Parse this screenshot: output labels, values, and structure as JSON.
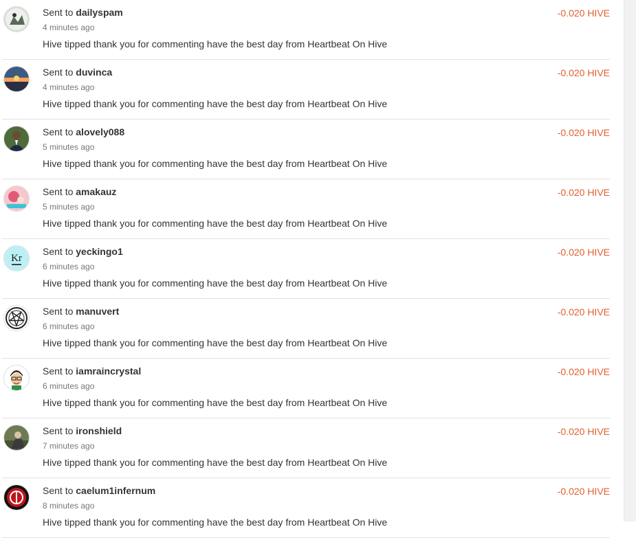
{
  "transfers": [
    {
      "prefix": "Sent to",
      "user": "dailyspam",
      "time": "4 minutes ago",
      "memo": "Hive tipped thank you for commenting have the best day from Heartbeat On Hive",
      "amount": "-0.020 HIVE",
      "avatar_icon": "dailyspam-avatar-icon"
    },
    {
      "prefix": "Sent to",
      "user": "duvinca",
      "time": "4 minutes ago",
      "memo": "Hive tipped thank you for commenting have the best day from Heartbeat On Hive",
      "amount": "-0.020 HIVE",
      "avatar_icon": "sunset-avatar-icon"
    },
    {
      "prefix": "Sent to",
      "user": "alovely088",
      "time": "5 minutes ago",
      "memo": "Hive tipped thank you for commenting have the best day from Heartbeat On Hive",
      "amount": "-0.020 HIVE",
      "avatar_icon": "person-avatar-icon"
    },
    {
      "prefix": "Sent to",
      "user": "amakauz",
      "time": "5 minutes ago",
      "memo": "Hive tipped thank you for commenting have the best day from Heartbeat On Hive",
      "amount": "-0.020 HIVE",
      "avatar_icon": "pink-avatar-icon"
    },
    {
      "prefix": "Sent to",
      "user": "yeckingo1",
      "time": "6 minutes ago",
      "memo": "Hive tipped thank you for commenting have the best day from Heartbeat On Hive",
      "amount": "-0.020 HIVE",
      "avatar_icon": "krypton-element-avatar-icon",
      "avatar_text": "Kr"
    },
    {
      "prefix": "Sent to",
      "user": "manuvert",
      "time": "6 minutes ago",
      "memo": "Hive tipped thank you for commenting have the best day from Heartbeat On Hive",
      "amount": "-0.020 HIVE",
      "avatar_icon": "pentagram-avatar-icon"
    },
    {
      "prefix": "Sent to",
      "user": "iamraincrystal",
      "time": "6 minutes ago",
      "memo": "Hive tipped thank you for commenting have the best day from Heartbeat On Hive",
      "amount": "-0.020 HIVE",
      "avatar_icon": "cartoon-face-avatar-icon"
    },
    {
      "prefix": "Sent to",
      "user": "ironshield",
      "time": "7 minutes ago",
      "memo": "Hive tipped thank you for commenting have the best day from Heartbeat On Hive",
      "amount": "-0.020 HIVE",
      "avatar_icon": "outdoor-avatar-icon"
    },
    {
      "prefix": "Sent to",
      "user": "caelum1infernum",
      "time": "8 minutes ago",
      "memo": "Hive tipped thank you for commenting have the best day from Heartbeat On Hive",
      "amount": "-0.020 HIVE",
      "avatar_icon": "red-emblem-avatar-icon"
    }
  ],
  "colors": {
    "amount": "#e05f2c",
    "divider": "#e2e2e2",
    "text": "#333333",
    "muted": "#777777"
  }
}
